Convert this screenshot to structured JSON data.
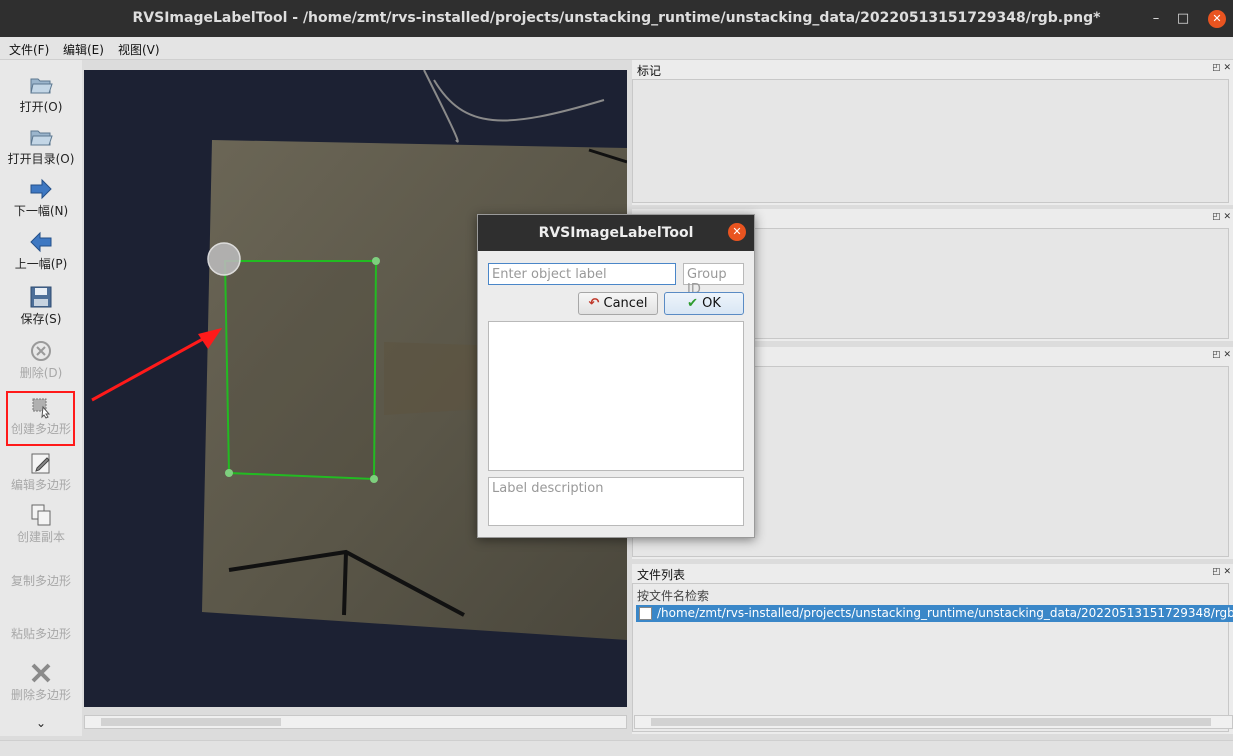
{
  "window": {
    "title": "RVSImageLabelTool - /home/zmt/rvs-installed/projects/unstacking_runtime/unstacking_data/20220513151729348/rgb.png*",
    "minimize": "–",
    "maximize": "□",
    "close": "✕"
  },
  "menu": {
    "file": "文件(F)",
    "edit": "编辑(E)",
    "view": "视图(V)"
  },
  "toolbar": {
    "open": "打开(O)",
    "open_dir": "打开目录(O)",
    "next": "下一幅(N)",
    "prev": "上一幅(P)",
    "save": "保存(S)",
    "delete": "删除(D)",
    "create_polygon": "创建多边形",
    "edit_polygon": "编辑多边形",
    "create_copy": "创建副本",
    "copy_polygon": "复制多边形",
    "paste_polygon": "粘贴多边形",
    "delete_polygon": "删除多边形",
    "more": "⌄"
  },
  "panels": {
    "labels_title": "标记",
    "file_list_title": "文件列表",
    "file_search": "按文件名检索",
    "file_item": "/home/zmt/rvs-installed/projects/unstacking_runtime/unstacking_data/20220513151729348/rgb"
  },
  "dialog": {
    "title": "RVSImageLabelTool",
    "label_placeholder": "Enter object label",
    "group_placeholder": "Group ID",
    "cancel": "Cancel",
    "ok": "OK",
    "description_placeholder": "Label description"
  },
  "colors": {
    "titlebar": "#2f2f2f",
    "close_button": "#e95420",
    "polygon": "#22bb22",
    "annotation_arrow": "#ff1a1a",
    "selection": "#3a87c8"
  }
}
